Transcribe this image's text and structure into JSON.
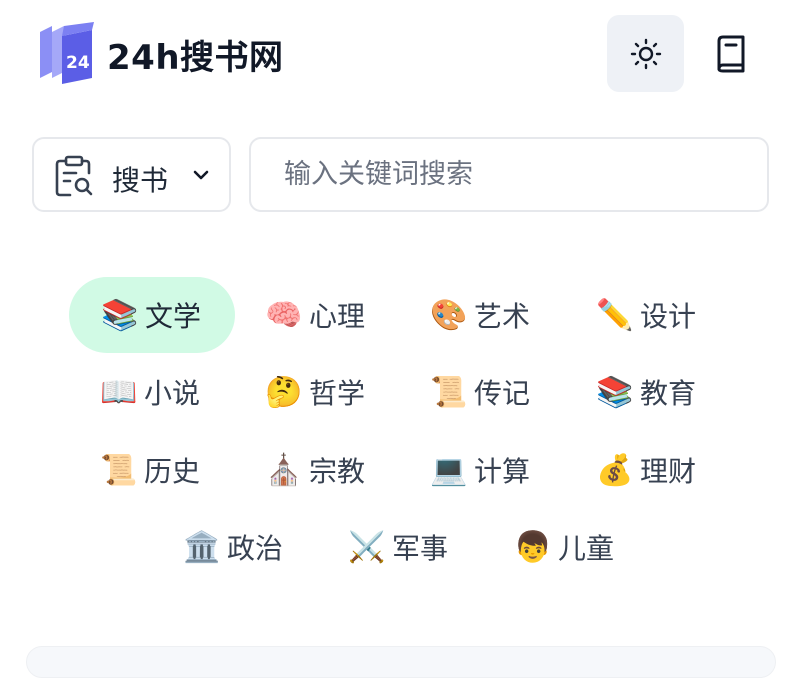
{
  "header": {
    "brand": "24h搜书网",
    "logo_text": "24",
    "theme_icon": "sun-icon",
    "book_icon": "book-icon"
  },
  "search": {
    "type_label": "搜书",
    "type_icon": "clipboard-search-icon",
    "placeholder": "输入关键词搜索",
    "value": ""
  },
  "categories": [
    {
      "emoji": "📚",
      "label": "文学",
      "active": true
    },
    {
      "emoji": "🧠",
      "label": "心理"
    },
    {
      "emoji": "🎨",
      "label": "艺术"
    },
    {
      "emoji": "✏️",
      "label": "设计"
    },
    {
      "emoji": "📖",
      "label": "小说"
    },
    {
      "emoji": "🤔",
      "label": "哲学"
    },
    {
      "emoji": "📜",
      "label": "传记"
    },
    {
      "emoji": "📚",
      "label": "教育"
    },
    {
      "emoji": "📜",
      "label": "历史"
    },
    {
      "emoji": "⛪",
      "label": "宗教"
    },
    {
      "emoji": "💻",
      "label": "计算"
    },
    {
      "emoji": "💰",
      "label": "理财"
    },
    {
      "emoji": "🏛️",
      "label": "政治"
    },
    {
      "emoji": "⚔️",
      "label": "军事"
    },
    {
      "emoji": "👦",
      "label": "儿童"
    }
  ],
  "colors": {
    "accent_active_bg": "#d1fae5",
    "logo_purple": "#6366f1",
    "theme_btn_bg": "#eef1f6"
  }
}
